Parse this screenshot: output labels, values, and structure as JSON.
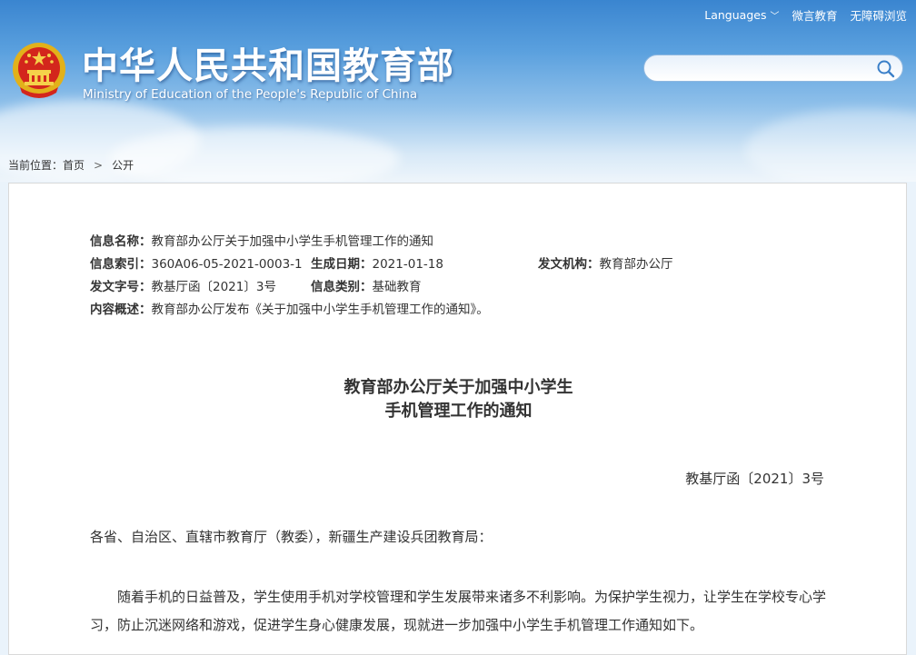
{
  "header": {
    "title_cn": "中华人民共和国教育部",
    "title_en": "Ministry of Education of the People's Republic of China",
    "links": {
      "languages": "Languages",
      "weibo": "微言教育",
      "accessibility": "无障碍浏览"
    },
    "search": {
      "placeholder": ""
    }
  },
  "breadcrumb": {
    "prefix": "当前位置：",
    "home": "首页",
    "current": "公开"
  },
  "meta": {
    "name_label": "信息名称：",
    "name_value": "教育部办公厅关于加强中小学生手机管理工作的通知",
    "index_label": "信息索引：",
    "index_value": "360A06-05-2021-0003-1",
    "date_label": "生成日期：",
    "date_value": "2021-01-18",
    "org_label": "发文机构：",
    "org_value": "教育部办公厅",
    "docno_label": "发文字号：",
    "docno_value": "教基厅函〔2021〕3号",
    "category_label": "信息类别：",
    "category_value": "基础教育",
    "summary_label": "内容概述：",
    "summary_value": "教育部办公厅发布《关于加强中小学生手机管理工作的通知》。"
  },
  "document": {
    "title_line1": "教育部办公厅关于加强中小学生",
    "title_line2": "手机管理工作的通知",
    "doc_number": "教基厅函〔2021〕3号",
    "salutation": "各省、自治区、直辖市教育厅（教委），新疆生产建设兵团教育局：",
    "paragraph1": "随着手机的日益普及，学生使用手机对学校管理和学生发展带来诸多不利影响。为保护学生视力，让学生在学校专心学习，防止沉迷网络和游戏，促进学生身心健康发展，现就进一步加强中小学生手机管理工作通知如下。"
  },
  "colors": {
    "banner_top": "#3a85d0",
    "text": "#333333"
  },
  "icons": {
    "emblem": "national-emblem-icon",
    "search": "search-icon",
    "chevron": "chevron-down-icon"
  }
}
